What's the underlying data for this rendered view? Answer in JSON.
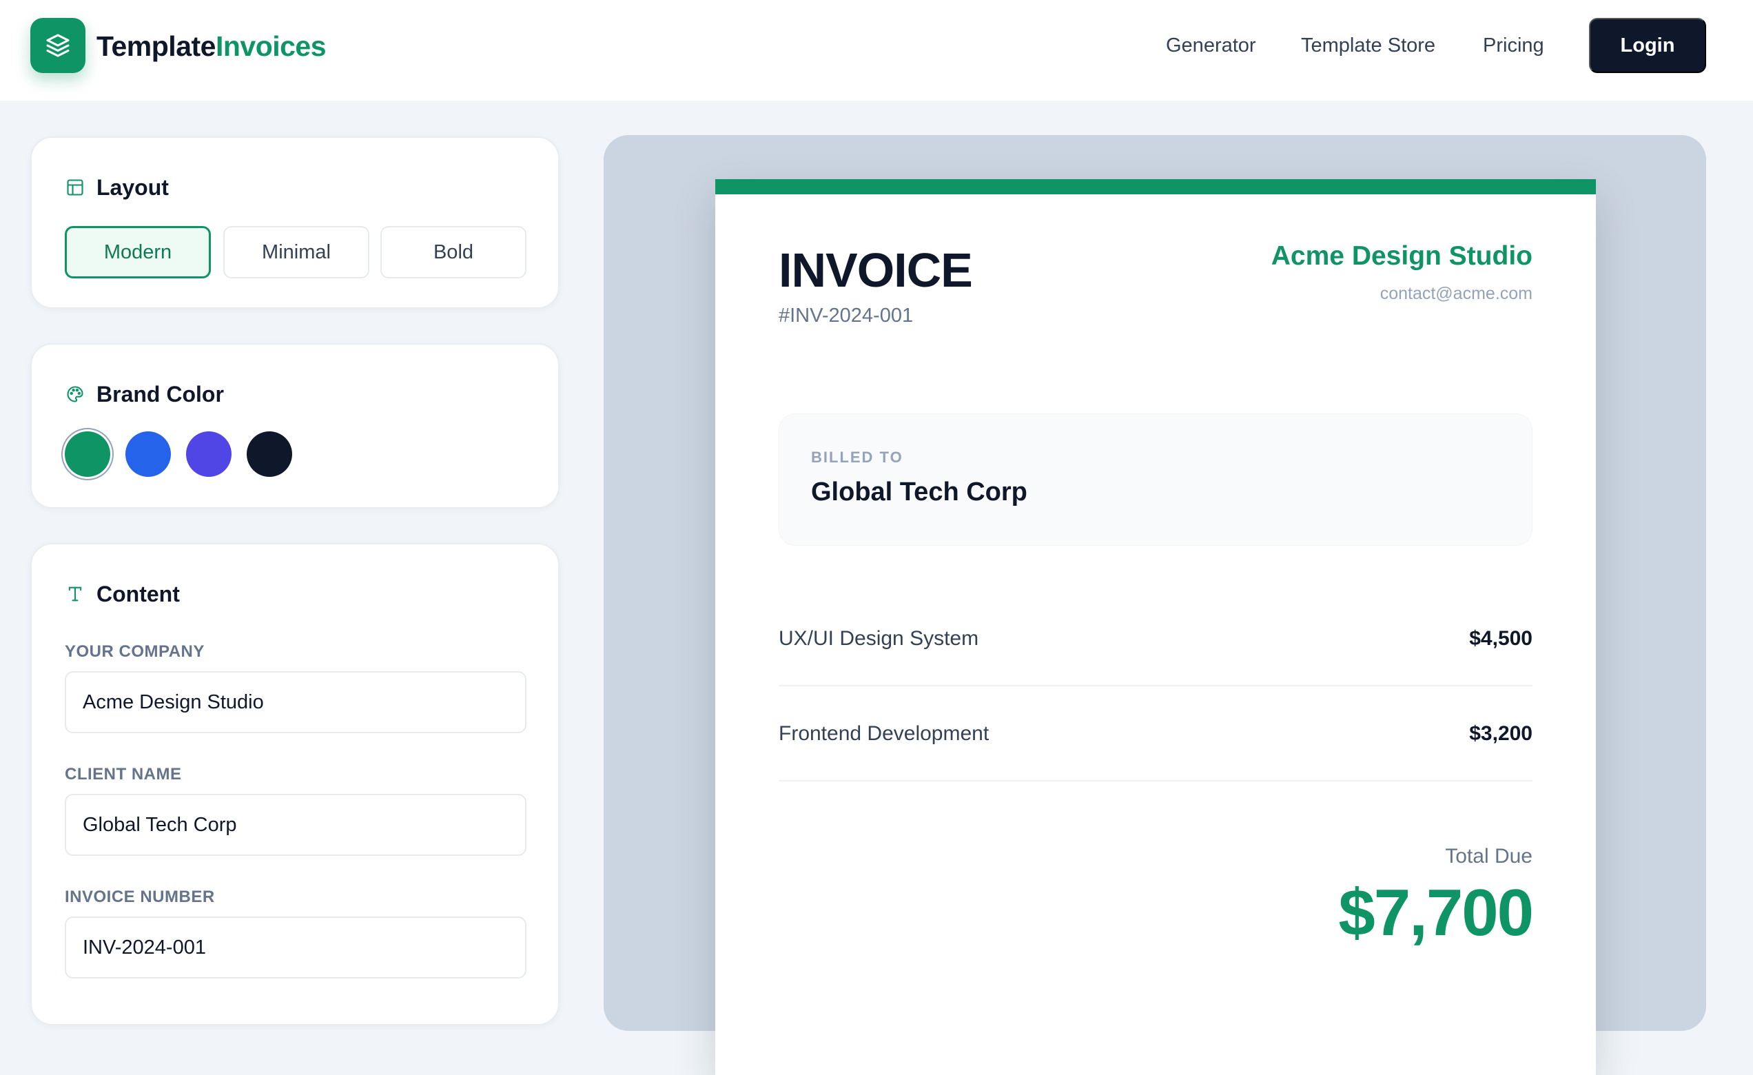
{
  "brand": {
    "name_part1": "Template",
    "name_part2": "Invoices",
    "logo_icon": "layers-icon",
    "accent_color": "#0f9466"
  },
  "nav": {
    "links": [
      "Generator",
      "Template Store",
      "Pricing"
    ],
    "login_label": "Login"
  },
  "sidebar": {
    "layout": {
      "title": "Layout",
      "icon": "layout-icon",
      "options": [
        "Modern",
        "Minimal",
        "Bold"
      ],
      "selected": "Modern"
    },
    "brand_color": {
      "title": "Brand Color",
      "icon": "palette-icon",
      "colors": [
        "#0f9466",
        "#2563eb",
        "#4f46e5",
        "#0f172a"
      ],
      "selected": "#0f9466"
    },
    "content": {
      "title": "Content",
      "icon": "text-icon",
      "fields": [
        {
          "label": "Your Company",
          "value": "Acme Design Studio"
        },
        {
          "label": "Client Name",
          "value": "Global Tech Corp"
        },
        {
          "label": "Invoice Number",
          "value": "INV-2024-001"
        }
      ]
    }
  },
  "invoice": {
    "title": "INVOICE",
    "number": "#INV-2024-001",
    "company": "Acme Design Studio",
    "email": "contact@acme.com",
    "billed_to_label": "BILLED TO",
    "client": "Global Tech Corp",
    "items": [
      {
        "description": "UX/UI Design System",
        "amount": "$4,500"
      },
      {
        "description": "Frontend Development",
        "amount": "$3,200"
      }
    ],
    "total_label": "Total Due",
    "total": "$7,700"
  }
}
